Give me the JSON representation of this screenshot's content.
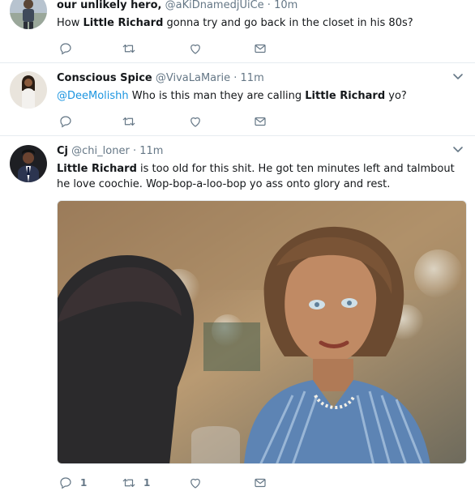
{
  "tweets": [
    {
      "name": "our unlikely hero,",
      "handle": "@aKiDnamedjUiCe",
      "separator": "·",
      "time": "10m",
      "text_segments": [
        {
          "t": "How ",
          "bold": false
        },
        {
          "t": "Little Richard",
          "bold": true
        },
        {
          "t": " gonna try and go back in the closet in his 80s?",
          "bold": false
        }
      ]
    },
    {
      "name": "Conscious Spice",
      "handle": "@VivaLaMarie",
      "separator": "·",
      "time": "11m",
      "mention": "@DeeMolishh",
      "text_pre": "  Who is this man they are calling ",
      "text_bold": "Little Richard",
      "text_post": " yo?"
    },
    {
      "name": "Cj",
      "handle": "@chi_loner",
      "separator": "·",
      "time": "11m",
      "text_bold": "Little Richard",
      "text_post": " is too old for this shit. He got ten minutes left and talmbout he love coochie. Wop-bop-a-loo-bop yo ass onto glory and rest.",
      "reply_count": "1",
      "retweet_count": "1"
    }
  ],
  "colors": {
    "text": "#14171a",
    "secondary": "#657786",
    "link": "#1b95e0",
    "divider": "#e6ecf0"
  },
  "icons": [
    "reply-icon",
    "retweet-icon",
    "like-icon",
    "direct-message-icon",
    "chevron-down-icon"
  ]
}
